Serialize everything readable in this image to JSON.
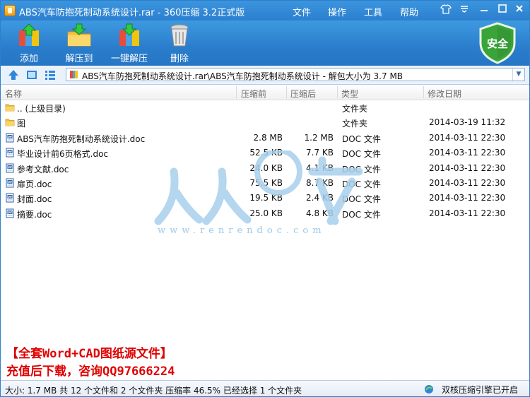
{
  "window": {
    "title": "ABS汽车防抱死制动系统设计.rar - 360压缩 3.2正式版",
    "menu": [
      "文件",
      "操作",
      "工具",
      "帮助"
    ]
  },
  "toolbar": {
    "add_label": "添加",
    "extract_to_label": "解压到",
    "one_click_extract_label": "一键解压",
    "delete_label": "删除",
    "safe_badge": "安全"
  },
  "address": {
    "path": "ABS汽车防抱死制动系统设计.rar\\ABS汽车防抱死制动系统设计 - 解包大小为 3.7 MB"
  },
  "columns": {
    "name": "名称",
    "compressed_before": "压缩前",
    "compressed_after": "压缩后",
    "type": "类型",
    "modified": "修改日期"
  },
  "rows": [
    {
      "name": ".. (上级目录)",
      "before": "",
      "after": "",
      "type": "文件夹",
      "date": "",
      "icon": "folder-icon"
    },
    {
      "name": "图",
      "before": "",
      "after": "",
      "type": "文件夹",
      "date": "2014-03-19 11:32",
      "icon": "folder-icon"
    },
    {
      "name": "ABS汽车防抱死制动系统设计.doc",
      "before": "2.8 MB",
      "after": "1.2 MB",
      "type": "DOC 文件",
      "date": "2014-03-11 22:30",
      "icon": "word-doc-icon"
    },
    {
      "name": "毕业设计前6页格式.doc",
      "before": "52.5 KB",
      "after": "7.7 KB",
      "type": "DOC 文件",
      "date": "2014-03-11 22:30",
      "icon": "word-doc-icon"
    },
    {
      "name": "参考文献.doc",
      "before": "24.0 KB",
      "after": "4.1 KB",
      "type": "DOC 文件",
      "date": "2014-03-11 22:30",
      "icon": "word-doc-icon"
    },
    {
      "name": "扉页.doc",
      "before": "75.5 KB",
      "after": "8.7 KB",
      "type": "DOC 文件",
      "date": "2014-03-11 22:30",
      "icon": "word-doc-icon"
    },
    {
      "name": "封面.doc",
      "before": "19.5 KB",
      "after": "2.4 KB",
      "type": "DOC 文件",
      "date": "2014-03-11 22:30",
      "icon": "word-doc-icon"
    },
    {
      "name": "摘要.doc",
      "before": "25.0 KB",
      "after": "4.8 KB",
      "type": "DOC 文件",
      "date": "2014-03-11 22:30",
      "icon": "word-doc-icon"
    }
  ],
  "watermark": {
    "url": "www.renrendoc.com"
  },
  "promo": {
    "line1": "【全套Word+CAD图纸源文件】",
    "line2": "充值后下载，咨询QQ97666224"
  },
  "status": {
    "summary": "大小: 1.7 MB 共 12 个文件和 2 个文件夹 压缩率 46.5% 已经选择 1 个文件夹",
    "engine": "双核压缩引擎已开启"
  },
  "colors": {
    "title_bar": "#2c7fcf",
    "promo_text": "#e00000",
    "safe_badge": "#3aa33a"
  }
}
